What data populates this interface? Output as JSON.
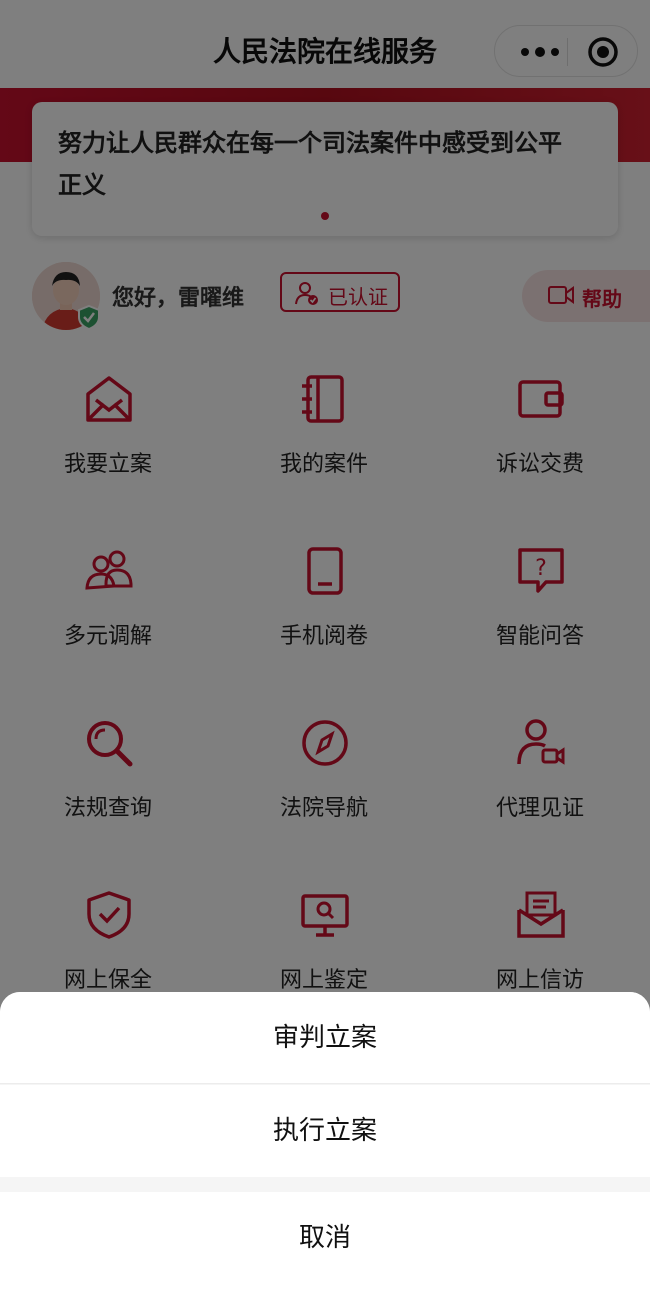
{
  "navbar": {
    "title": "人民法院在线服务",
    "more_icon": "more-dots-icon",
    "close_icon": "target-circle-icon"
  },
  "notice": {
    "text": "努力让人民群众在每一个司法案件中感受到公平正义"
  },
  "user": {
    "greeting": "您好，雷曜维",
    "verified_label": "已认证",
    "help_label": "帮助"
  },
  "services": [
    {
      "label": "我要立案",
      "icon": "envelope-open-icon"
    },
    {
      "label": "我的案件",
      "icon": "notebook-icon"
    },
    {
      "label": "诉讼交费",
      "icon": "wallet-icon"
    },
    {
      "label": "多元调解",
      "icon": "people-icon"
    },
    {
      "label": "手机阅卷",
      "icon": "phone-icon"
    },
    {
      "label": "智能问答",
      "icon": "question-bubble-icon"
    },
    {
      "label": "法规查询",
      "icon": "search-icon"
    },
    {
      "label": "法院导航",
      "icon": "compass-icon"
    },
    {
      "label": "代理见证",
      "icon": "person-video-icon"
    },
    {
      "label": "网上保全",
      "icon": "shield-check-icon"
    },
    {
      "label": "网上鉴定",
      "icon": "monitor-search-icon"
    },
    {
      "label": "网上信访",
      "icon": "mail-letter-icon"
    }
  ],
  "action_sheet": {
    "options": [
      "审判立案",
      "执行立案"
    ],
    "cancel_label": "取消"
  },
  "colors": {
    "accent": "#c8102e",
    "mask": "rgba(0,0,0,0.5)"
  }
}
